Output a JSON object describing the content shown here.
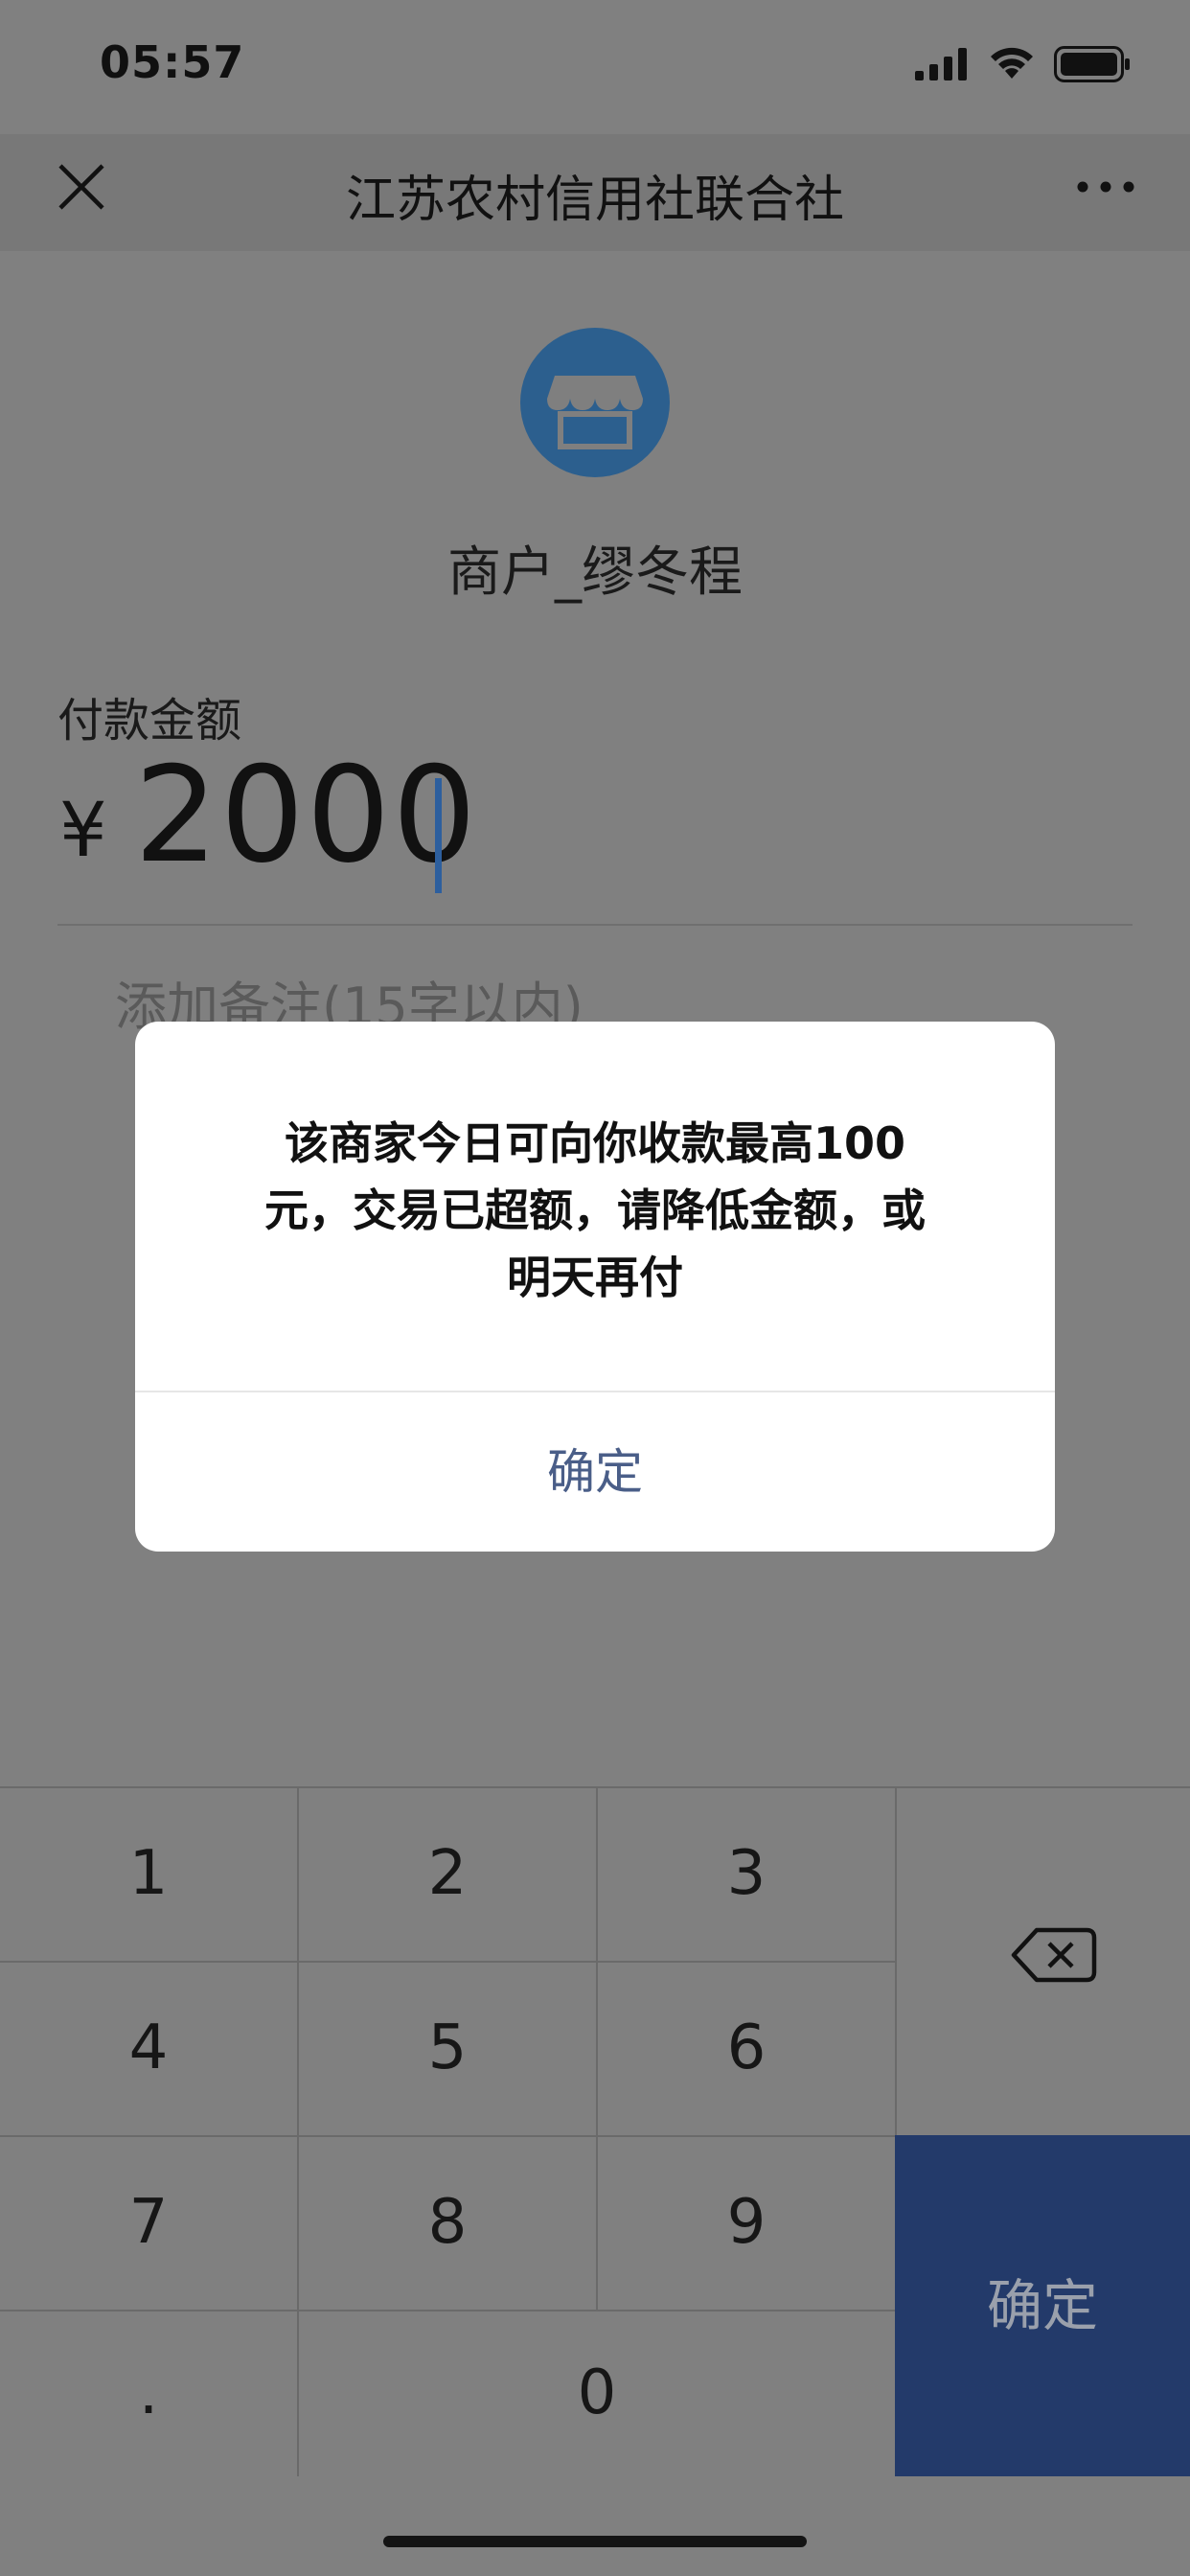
{
  "status_bar": {
    "time": "05:57"
  },
  "nav": {
    "title": "江苏农村信用社联合社"
  },
  "merchant": {
    "name": "商户_缪冬程"
  },
  "payment": {
    "amount_label": "付款金额",
    "currency_symbol": "¥",
    "amount": "2000",
    "remark_placeholder": "添加备注(15字以内)"
  },
  "dialog": {
    "message_line1": "该商家今日可向你收款最高100",
    "message_line2": "元，交易已超额，请降低金额，或",
    "message_line3": "明天再付",
    "confirm_label": "确定"
  },
  "keypad": {
    "keys": [
      "1",
      "2",
      "3",
      "4",
      "5",
      "6",
      "7",
      "8",
      "9",
      ".",
      "0"
    ],
    "confirm_label": "确定"
  },
  "colors": {
    "confirm_blue": "#233a6a",
    "dialog_link": "#4a5e88",
    "avatar_blue": "#2c5f8e"
  }
}
